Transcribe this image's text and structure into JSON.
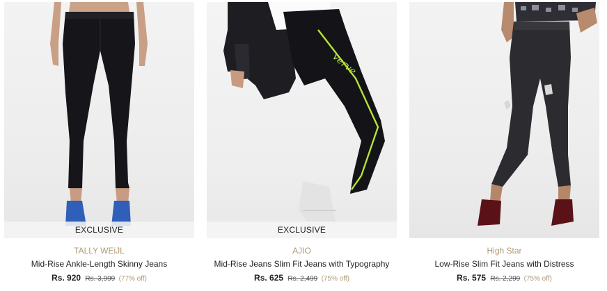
{
  "products": [
    {
      "tag": "EXCLUSIVE",
      "brand": "TALLY WEiJL",
      "title": "Mid-Rise Ankle-Length Skinny Jeans",
      "price": "Rs. 920",
      "mrp": "Rs. 3,999",
      "discount": "(77% off)"
    },
    {
      "tag": "EXCLUSIVE",
      "brand": "AJIO",
      "title": "Mid-Rise Jeans Slim Fit Jeans with Typography",
      "price": "Rs. 625",
      "mrp": "Rs. 2,499",
      "discount": "(75% off)"
    },
    {
      "brand": "High Star",
      "title": "Low-Rise Slim Fit Jeans with Distress",
      "price": "Rs. 575",
      "mrp": "Rs. 2,299",
      "discount": "(75% off)"
    }
  ],
  "colors": {
    "brand": "#b19975",
    "tag_bg": "#f5f5f5"
  }
}
